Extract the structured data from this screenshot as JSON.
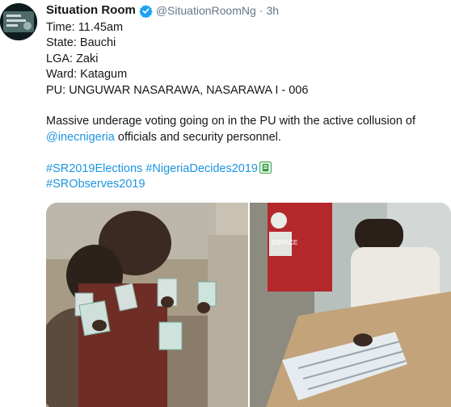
{
  "tweet": {
    "author_name": "Situation Room",
    "handle": "@SituationRoomNg",
    "separator": "·",
    "time_ago": "3h",
    "lines": {
      "time": "Time: 11.45am",
      "state": "State: Bauchi",
      "lga": "LGA: Zaki",
      "ward": "Ward: Katagum",
      "pu": "PU: UNGUWAR NASARAWA, NASARAWA I - 006"
    },
    "body_prefix": "Massive underage voting going on in the PU with the active collusion of",
    "mention": "@inecnigeria",
    "body_suffix": " officials and security personnel.",
    "hashtags": {
      "tag1": "#SR2019Elections",
      "tag2": "#NigeriaDecides2019",
      "tag3": "#SRObserves2019"
    },
    "photo_overlay_texts": {
      "shirt_text": "RSPACE"
    }
  },
  "colors": {
    "link": "#1b95e0",
    "verified": "#1da1f2",
    "meta_gray": "#657786"
  },
  "icons": {
    "verified": "verified-badge-icon",
    "hashtag_emoji": "ballot-box-emoji-icon"
  }
}
